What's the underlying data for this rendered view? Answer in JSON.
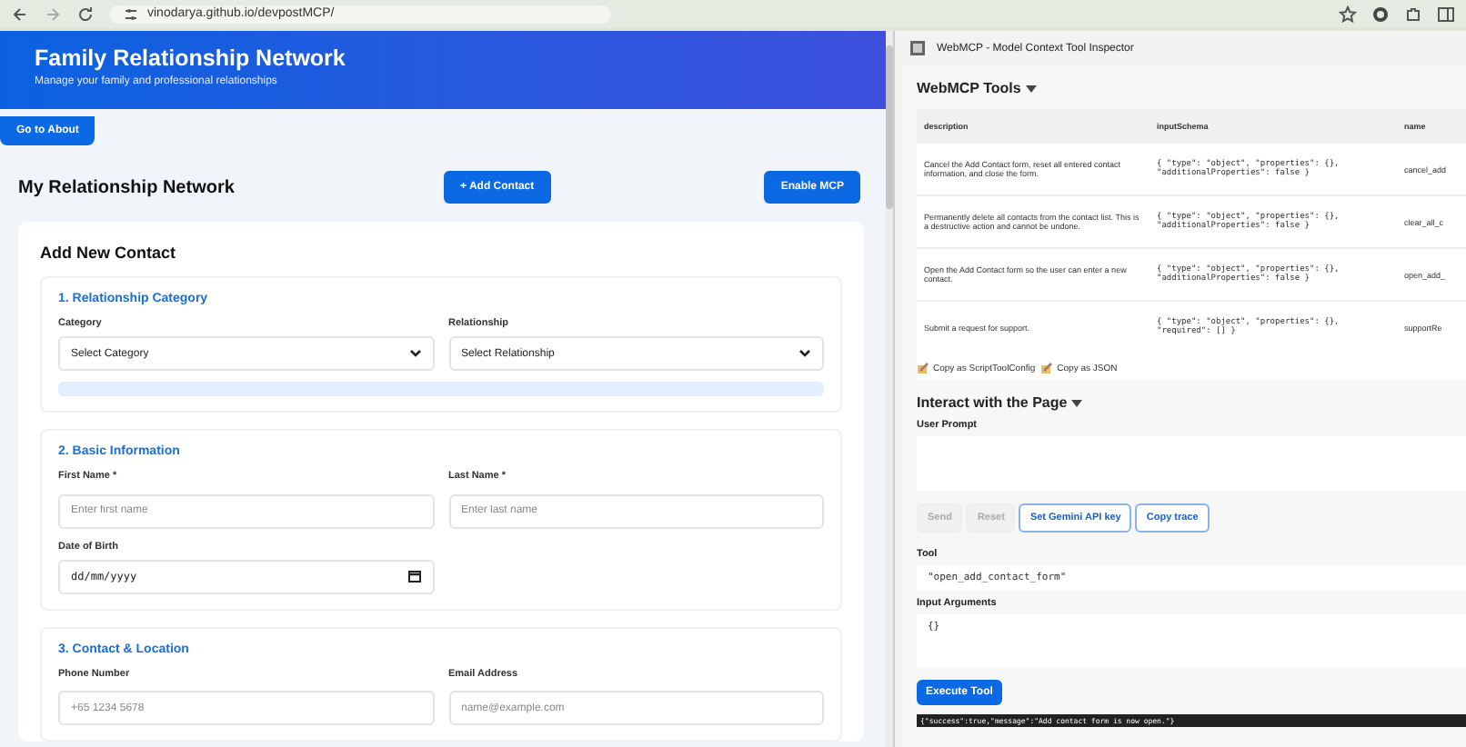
{
  "browser": {
    "url": "vinodarya.github.io/devpostMCP/"
  },
  "header": {
    "title": "Family Relationship Network",
    "subtitle": "Manage your family and professional relationships"
  },
  "about_button": "Go to About",
  "toolbar": {
    "title": "My Relationship Network",
    "add_button": "+ Add Contact",
    "mcp_button": "Enable MCP"
  },
  "form": {
    "title": "Add New Contact",
    "sections": [
      {
        "title": "1. Relationship Category",
        "fields": [
          {
            "kind": "select",
            "label": "Category",
            "value": "Select Category"
          },
          {
            "kind": "select",
            "label": "Relationship",
            "value": "Select Relationship"
          }
        ],
        "info_bar": true
      },
      {
        "title": "2. Basic Information",
        "fields": [
          {
            "kind": "text",
            "label": "First Name *",
            "placeholder": "Enter first name"
          },
          {
            "kind": "text",
            "label": "Last Name *",
            "placeholder": "Enter last name"
          },
          {
            "kind": "date",
            "label": "Date of Birth",
            "placeholder": "dd/mm/yyyy"
          }
        ],
        "info_bar": false
      },
      {
        "title": "3. Contact & Location",
        "fields": [
          {
            "kind": "text",
            "label": "Phone Number",
            "placeholder": "+65 1234 5678"
          },
          {
            "kind": "text",
            "label": "Email Address",
            "placeholder": "name@example.com"
          }
        ],
        "info_bar": false
      }
    ]
  },
  "inspector": {
    "title": "WebMCP - Model Context Tool Inspector",
    "tools_heading": "WebMCP Tools",
    "columns": [
      "description",
      "inputSchema",
      "name"
    ],
    "rows": [
      {
        "description": "Cancel the Add Contact form, reset all entered contact information, and close the form.",
        "schema": "{ \"type\": \"object\", \"properties\": {}, \"additionalProperties\": false }",
        "name": "cancel_add"
      },
      {
        "description": "Permanently delete all contacts from the contact list. This is a destructive action and cannot be undone.",
        "schema": "{ \"type\": \"object\", \"properties\": {}, \"additionalProperties\": false }",
        "name": "clear_all_c"
      },
      {
        "description": "Open the Add Contact form so the user can enter a new contact.",
        "schema": "{ \"type\": \"object\", \"properties\": {}, \"additionalProperties\": false }",
        "name": "open_add_"
      },
      {
        "description": "Submit a request for support.",
        "schema": "{ \"type\": \"object\", \"properties\": {}, \"required\": [] }",
        "name": "supportRe"
      }
    ],
    "copy_links": [
      "Copy as ScriptToolConfig",
      "Copy as JSON"
    ],
    "interact_heading": "Interact with the Page",
    "prompt_label": "User Prompt",
    "buttons": [
      {
        "label": "Send",
        "kind": "plain",
        "disabled": true
      },
      {
        "label": "Reset",
        "kind": "plain",
        "disabled": true
      },
      {
        "label": "Set Gemini API key",
        "kind": "outline",
        "disabled": false
      },
      {
        "label": "Copy trace",
        "kind": "outline",
        "disabled": false
      }
    ],
    "tool_label": "Tool",
    "tool_value": "\"open_add_contact_form\"",
    "args_label": "Input Arguments",
    "args_value": "{}",
    "execute_button": "Execute Tool",
    "result": "{\"success\":true,\"message\":\"Add contact form is now open.\"}"
  }
}
